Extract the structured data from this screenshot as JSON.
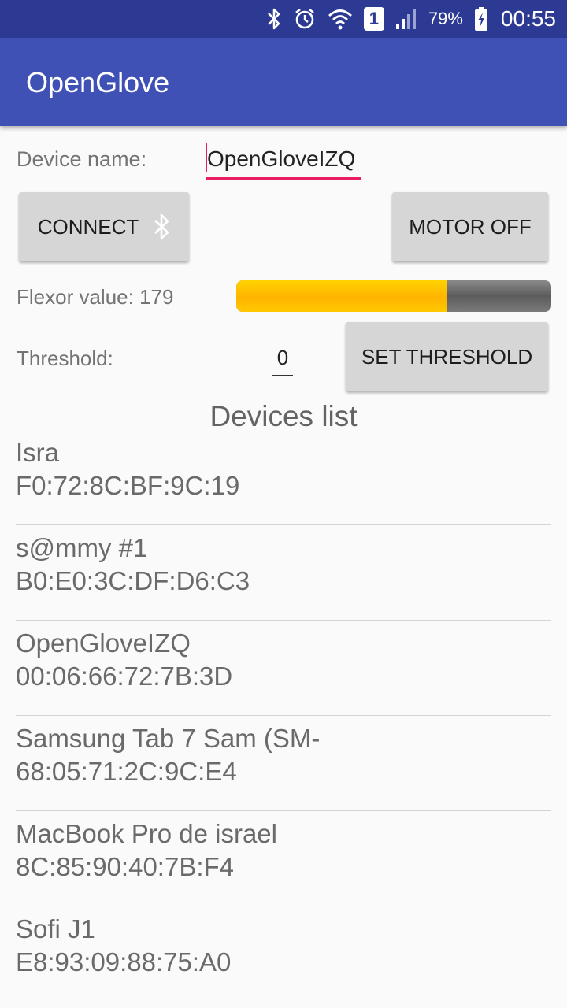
{
  "status_bar": {
    "icons": [
      "bluetooth-icon",
      "alarm-icon",
      "wifi-icon",
      "sim-icon",
      "signal-icon",
      "battery-icon"
    ],
    "sim_label": "1",
    "battery": "79%",
    "time": "00:55"
  },
  "app": {
    "title": "OpenGlove",
    "primary_color": "#3f51b5",
    "status_color": "#2c3a94",
    "accent_color": "#e91e63"
  },
  "form": {
    "device_name_label": "Device name:",
    "device_name_value": "OpenGloveIZQ",
    "connect_label": "CONNECT",
    "connect_icon": "bluetooth-icon",
    "motor_label": "MOTOR OFF",
    "flexor_label": "Flexor value: 179",
    "flexor_progress": 0.67,
    "threshold_label": "Threshold:",
    "threshold_value": "0",
    "set_threshold_label": "SET THRESHOLD"
  },
  "devices": {
    "title": "Devices list",
    "items": [
      {
        "name": "Isra",
        "address": "F0:72:8C:BF:9C:19"
      },
      {
        "name": "s@mmy #1",
        "address": "B0:E0:3C:DF:D6:C3"
      },
      {
        "name": "OpenGloveIZQ",
        "address": "00:06:66:72:7B:3D"
      },
      {
        "name": "Samsung Tab 7 Sam (SM-",
        "address": "68:05:71:2C:9C:E4"
      },
      {
        "name": "MacBook Pro de israel",
        "address": "8C:85:90:40:7B:F4"
      },
      {
        "name": "Sofi J1",
        "address": "E8:93:09:88:75:A0"
      }
    ]
  }
}
